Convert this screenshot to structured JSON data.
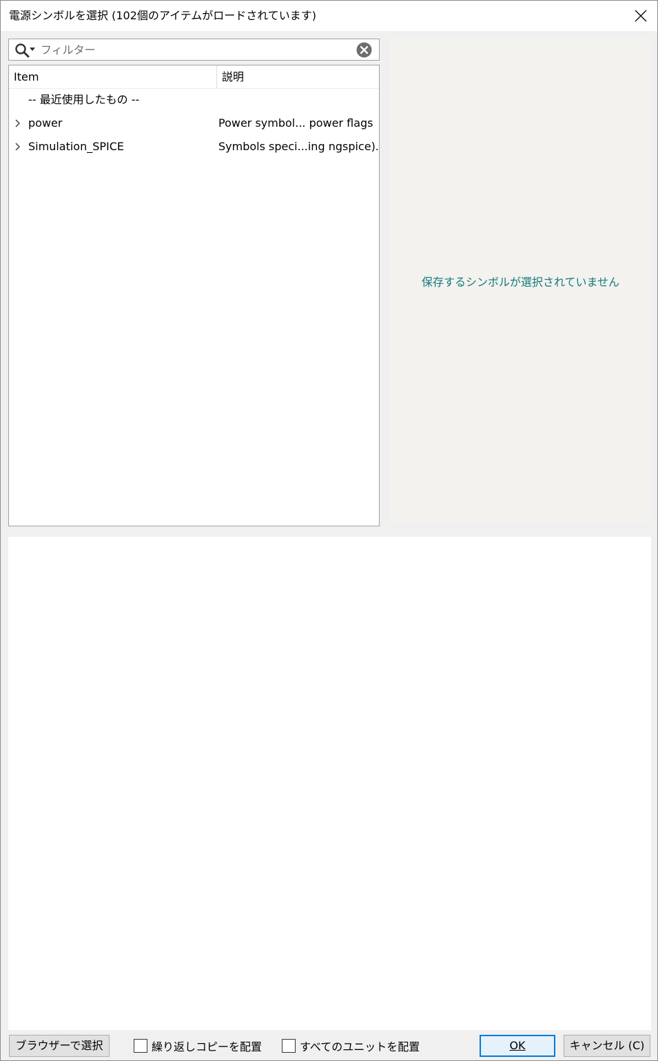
{
  "window": {
    "title": "電源シンボルを選択 (102個のアイテムがロードされています)"
  },
  "filter": {
    "placeholder": "フィルター",
    "value": ""
  },
  "tree": {
    "columns": [
      "Item",
      "説明"
    ],
    "rows": [
      {
        "name": "-- 最近使用したもの --",
        "description": "",
        "expandable": false
      },
      {
        "name": "power",
        "description": "Power symbol... power flags",
        "expandable": true
      },
      {
        "name": "Simulation_SPICE",
        "description": "Symbols speci...ing ngspice).",
        "expandable": true
      }
    ]
  },
  "preview": {
    "message": "保存するシンボルが選択されていません"
  },
  "footer": {
    "browse_label": "ブラウザーで選択",
    "repeat_copy_label": "繰り返しコピーを配置",
    "repeat_copy_checked": false,
    "all_units_label": "すべてのユニットを配置",
    "all_units_checked": false,
    "ok_label": "OK",
    "cancel_label": "キャンセル (C)"
  },
  "colors": {
    "preview_bg": "#f3f2ee",
    "preview_message": "#127a7a",
    "ok_focus_border": "#0078d7"
  }
}
